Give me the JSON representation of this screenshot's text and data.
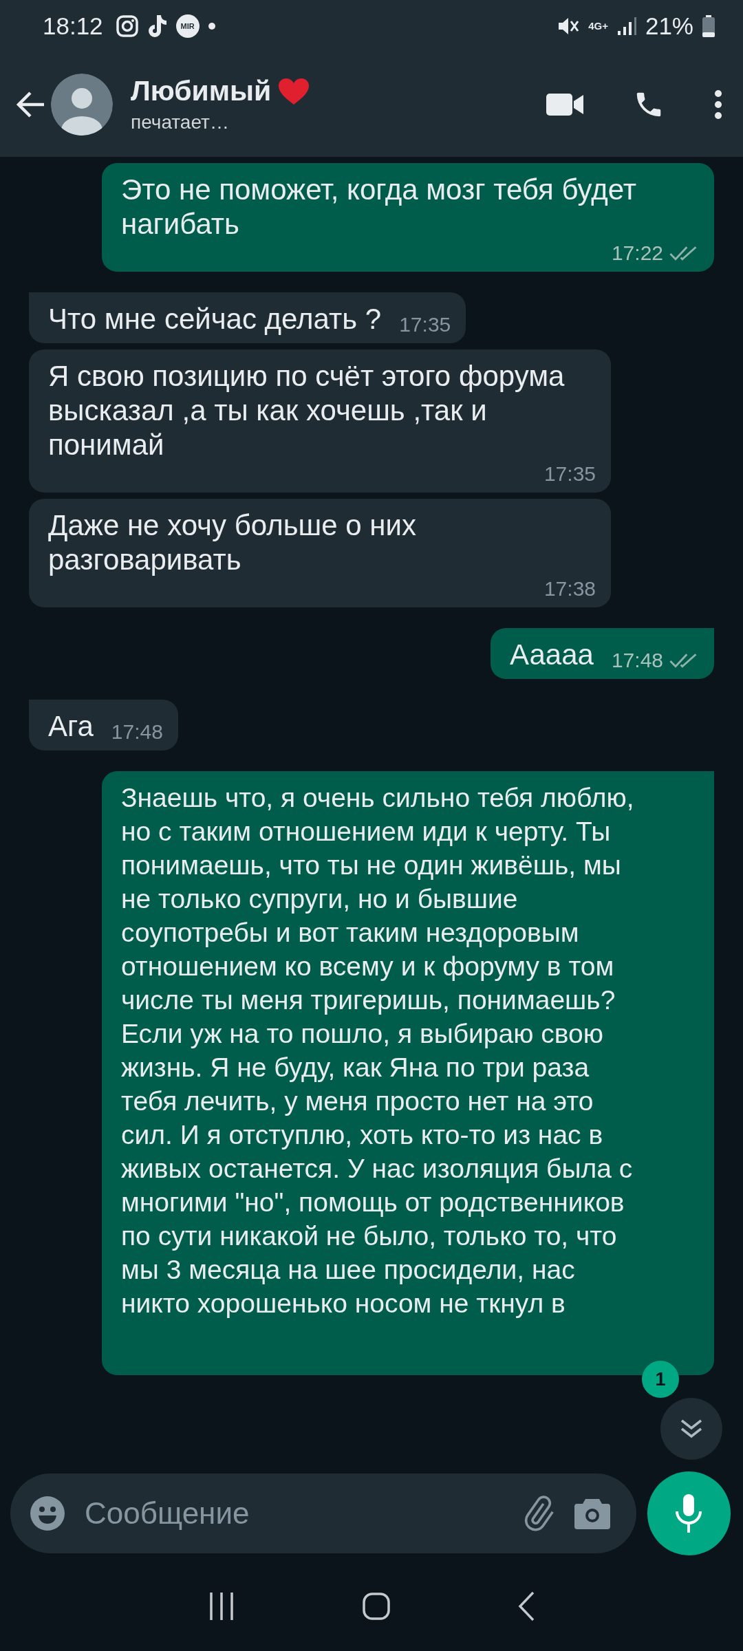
{
  "status_bar": {
    "time": "18:12",
    "app_badge": "MIR",
    "network": "4G+",
    "battery": "21%"
  },
  "header": {
    "name": "Любимый",
    "status": "печатает…"
  },
  "messages": [
    {
      "kind": "outgoing",
      "tail": false,
      "text": "Это не поможет, когда мозг тебя будет нагибать",
      "time": "17:22",
      "read": false
    },
    {
      "kind": "incoming",
      "tail": true,
      "text": "Что мне сейчас делать ?",
      "time": "17:35"
    },
    {
      "kind": "incoming",
      "tail": false,
      "text": "Я свою позицию по счёт этого форума высказал ,а ты как хочешь ,так и понимай",
      "time": "17:35"
    },
    {
      "kind": "incoming",
      "tail": false,
      "text": "Даже не хочу больше о них разговаривать",
      "time": "17:38"
    },
    {
      "kind": "outgoing",
      "tail": true,
      "text": "Ааааа",
      "time": "17:48",
      "read": false
    },
    {
      "kind": "incoming",
      "tail": true,
      "text": "Ага",
      "time": "17:48"
    },
    {
      "kind": "outgoing",
      "tail": true,
      "text": "Знаешь что, я очень сильно тебя люблю, но с таким отношением иди к черту. Ты понимаешь, что ты не один живёшь, мы не только супруги, но и бывшие соупотребы и вот таким нездоровым отношением ко всему и к форуму в том числе ты меня тригеришь, понимаешь? Если уж на то пошло, я выбираю свою жизнь. Я не буду, как Яна по три раза тебя лечить, у меня просто нет на это сил. И я отступлю, хоть кто-то из нас в живых останется. У нас изоляция была с многими \"но\", помощь от родственников по сути никакой не было, только то, что мы 3 месяца на шее просидели, нас никто хорошенько носом не ткнул в"
    }
  ],
  "unread_badge": "1",
  "composer": {
    "placeholder": "Сообщение"
  }
}
